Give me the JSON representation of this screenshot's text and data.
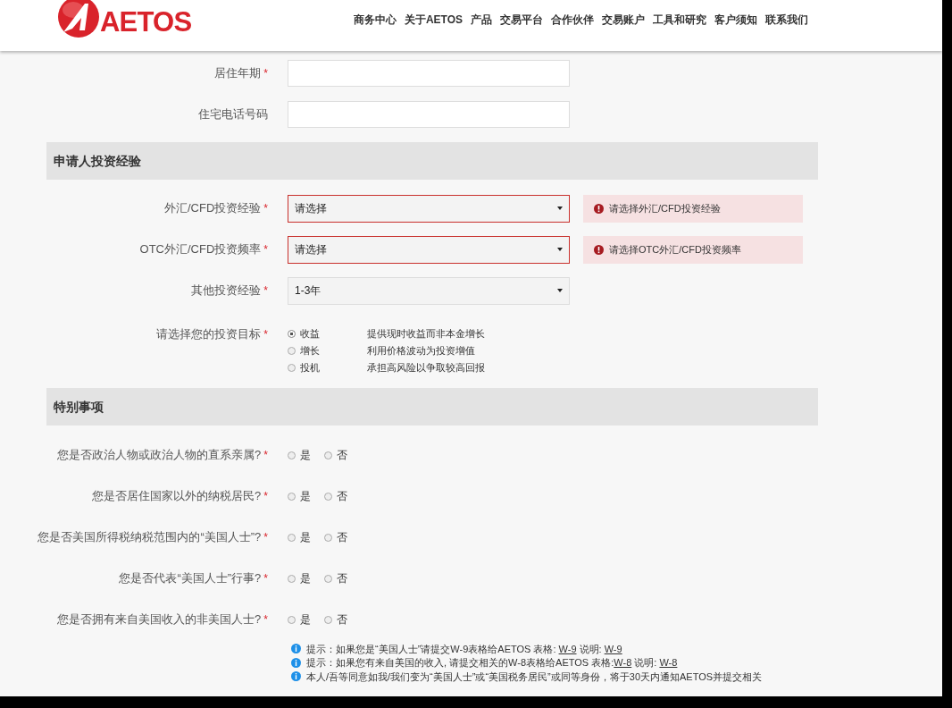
{
  "header": {
    "logo": "AETOS",
    "nav": [
      "商务中心",
      "关于AETOS",
      "产品",
      "交易平台",
      "合作伙伴",
      "交易账户",
      "工具和研究",
      "客户须知",
      "联系我们"
    ]
  },
  "top_fields": [
    {
      "label": "居住年期",
      "required_mark": "*"
    },
    {
      "label": "住宅电话号码"
    }
  ],
  "sections": [
    {
      "title": "申请人投资经验",
      "rows": [
        {
          "kind": "select",
          "label": "外汇/CFD投资经验",
          "required_mark": "*",
          "value": "请选择",
          "error": "请选择外汇/CFD投资经验"
        },
        {
          "kind": "select",
          "label": "OTC外汇/CFD投资频率",
          "required_mark": "*",
          "value": "请选择",
          "error": "请选择OTC外汇/CFD投资频率"
        },
        {
          "kind": "select",
          "label": "其他投资经验",
          "required_mark": "*",
          "value": "1-3年"
        },
        {
          "kind": "radio_list",
          "label": "请选择您的投资目标",
          "required_mark": "*",
          "options": [
            {
              "label": "收益",
              "description": "提供现时收益而非本金增长",
              "selected": true
            },
            {
              "label": "增长",
              "description": "利用价格波动为投资增值",
              "selected": false
            },
            {
              "label": "投机",
              "description": "承担高风险以争取较高回报",
              "selected": false
            }
          ]
        }
      ]
    },
    {
      "title": "特别事项",
      "rows": [
        {
          "kind": "yes_no",
          "label": "您是否政治人物或政治人物的直系亲属?",
          "required_mark": "*",
          "options": [
            {
              "label": "是",
              "selected": false
            },
            {
              "label": "否",
              "selected": false
            }
          ]
        },
        {
          "kind": "yes_no",
          "label": "您是否居住国家以外的纳税居民?",
          "required_mark": "*",
          "options": [
            {
              "label": "是",
              "selected": false
            },
            {
              "label": "否",
              "selected": false
            }
          ]
        },
        {
          "kind": "yes_no",
          "label": "您是否美国所得税纳税范围内的“美国人士”?",
          "required_mark": "*",
          "options": [
            {
              "label": "是",
              "selected": false
            },
            {
              "label": "否",
              "selected": false
            }
          ]
        },
        {
          "kind": "yes_no",
          "label": "您是否代表“美国人士”行事?",
          "required_mark": "*",
          "options": [
            {
              "label": "是",
              "selected": false
            },
            {
              "label": "否",
              "selected": false
            }
          ]
        },
        {
          "kind": "yes_no",
          "label": "您是否拥有来自美国收入的非美国人士?",
          "required_mark": "*",
          "options": [
            {
              "label": "是",
              "selected": false
            },
            {
              "label": "否",
              "selected": false
            }
          ]
        }
      ]
    }
  ],
  "notes": [
    [
      {
        "text": "提示：如果您是“美国人士”请提交W-9表格给AETOS 表格: "
      },
      {
        "link": "W-9"
      },
      {
        "text": " 说明: "
      },
      {
        "link": "W-9"
      }
    ],
    [
      {
        "text": "提示：如果您有来自美国的收入, 请提交相关的W-8表格给AETOS 表格:"
      },
      {
        "link": "W-8"
      },
      {
        "text": " 说明: "
      },
      {
        "link": "W-8"
      }
    ],
    [
      {
        "text": "本人/吾等同意如我/我们变为“美国人士”或“美国税务居民”或同等身份，将于30天内通知AETOS并提交相关"
      }
    ]
  ]
}
